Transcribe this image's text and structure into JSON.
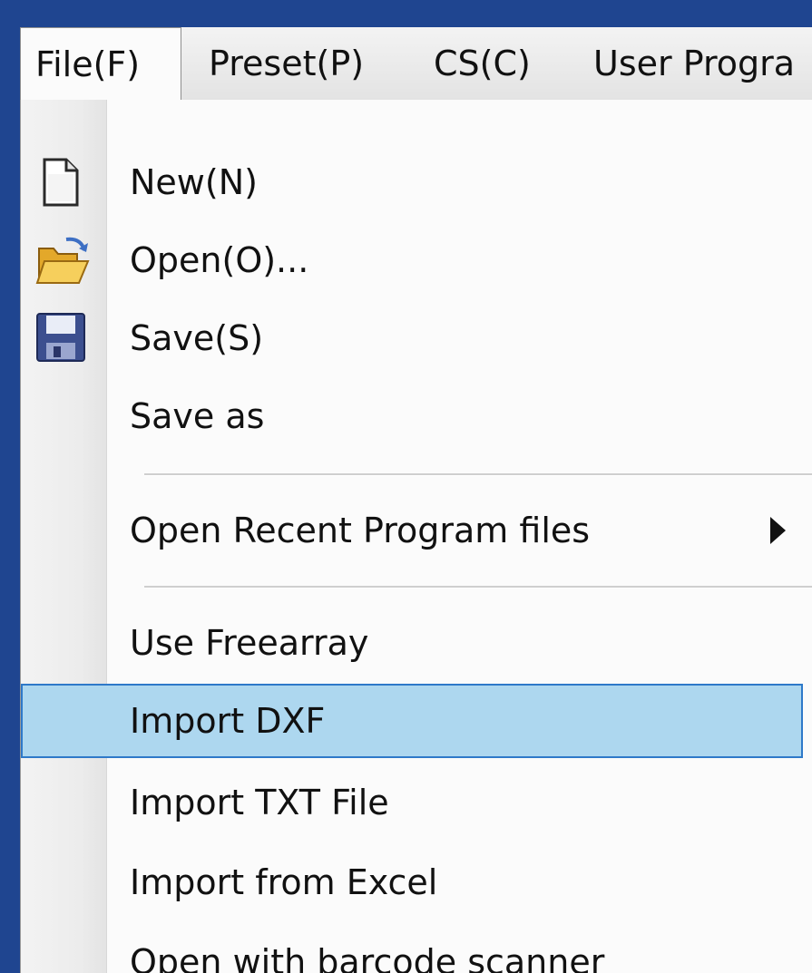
{
  "menubar": {
    "items": [
      {
        "label": "File(F)",
        "active": true
      },
      {
        "label": "Preset(P)"
      },
      {
        "label": "CS(C)"
      },
      {
        "label": "User Progra"
      }
    ]
  },
  "file_menu": {
    "items": [
      {
        "label": "New(N)",
        "icon": "new-file-icon"
      },
      {
        "label": "Open(O)...",
        "icon": "open-folder-icon"
      },
      {
        "label": "Save(S)",
        "icon": "save-floppy-icon"
      },
      {
        "label": "Save as"
      },
      {
        "label": "Open Recent Program files",
        "submenu": true
      },
      {
        "label": "Use Freearray"
      },
      {
        "label": "Import DXF",
        "highlighted": true
      },
      {
        "label": "Import TXT File"
      },
      {
        "label": "Import from Excel"
      },
      {
        "label": "Open with barcode scanner"
      }
    ]
  },
  "colors": {
    "background": "#1f4590",
    "highlight_fill": "#add7ef",
    "highlight_border": "#2e79c9"
  }
}
